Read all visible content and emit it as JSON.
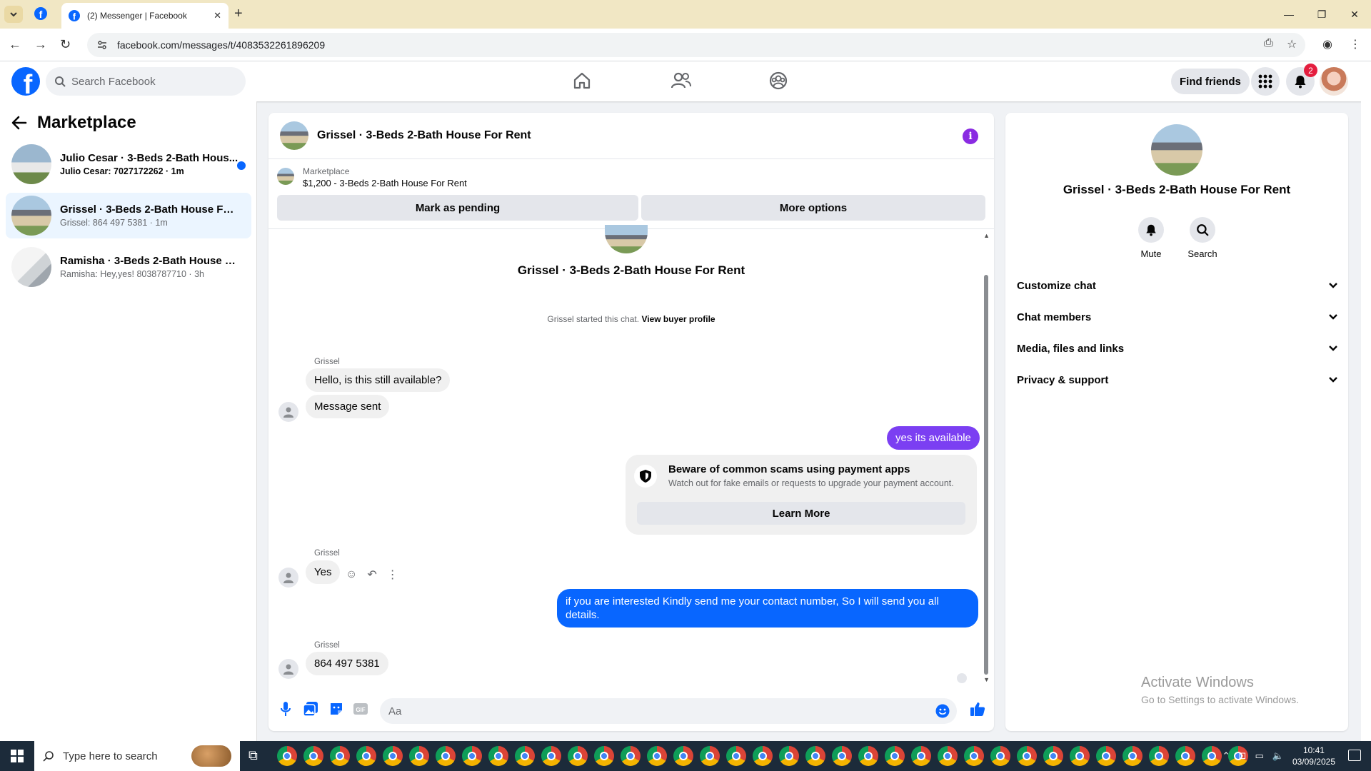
{
  "browser": {
    "tab_title": "(2) Messenger | Facebook",
    "url": "facebook.com/messages/t/4083532261896209"
  },
  "fb": {
    "search_placeholder": "Search Facebook",
    "find_friends": "Find friends",
    "notification_count": "2",
    "brand_color": "#0866ff"
  },
  "left": {
    "title": "Marketplace",
    "chats": [
      {
        "name": "Julio Cesar · 3-Beds 2-Bath Hous...",
        "sub": "Julio Cesar: 7027172262 · 1m",
        "unread": true
      },
      {
        "name": "Grissel · 3-Beds 2-Bath House For ...",
        "sub": "Grissel: 864 497 5381 · 1m",
        "active": true
      },
      {
        "name": "Ramisha · 3-Beds 2-Bath House Fo...",
        "sub": "Ramisha: Hey,yes! 8038787710 · 3h"
      }
    ]
  },
  "convo": {
    "title": "Grissel · 3-Beds 2-Bath House For Rent",
    "listing_source": "Marketplace",
    "listing_name": "$1,200 - 3-Beds 2-Bath House For Rent",
    "mark_pending": "Mark as pending",
    "more_options": "More options",
    "center_name": "Grissel · 3-Beds 2-Bath House For Rent",
    "started_text": "Grissel started this chat.",
    "view_buyer": "View buyer profile",
    "messages": {
      "m1_sender": "Grissel",
      "m1": "Hello, is this still available?",
      "m2": "Message sent",
      "m3": "yes its available",
      "scam_title": "Beware of common scams using payment apps",
      "scam_sub": "Watch out for fake emails or requests to upgrade your payment account.",
      "learn_more": "Learn More",
      "m4_sender": "Grissel",
      "m4": "Yes",
      "m5": "if you are interested Kindly send me your contact number, So I will send you all details.",
      "m6_sender": "Grissel",
      "m6": "864 497 5381"
    },
    "composer_placeholder": "Aa"
  },
  "info": {
    "title": "Grissel · 3-Beds 2-Bath House For Rent",
    "mute": "Mute",
    "search": "Search",
    "rows": [
      "Customize chat",
      "Chat members",
      "Media, files and links",
      "Privacy & support"
    ]
  },
  "watermark": {
    "line1": "Activate Windows",
    "line2": "Go to Settings to activate Windows."
  },
  "taskbar": {
    "search_placeholder": "Type here to search",
    "time": "10:41",
    "date": "03/09/2025"
  }
}
